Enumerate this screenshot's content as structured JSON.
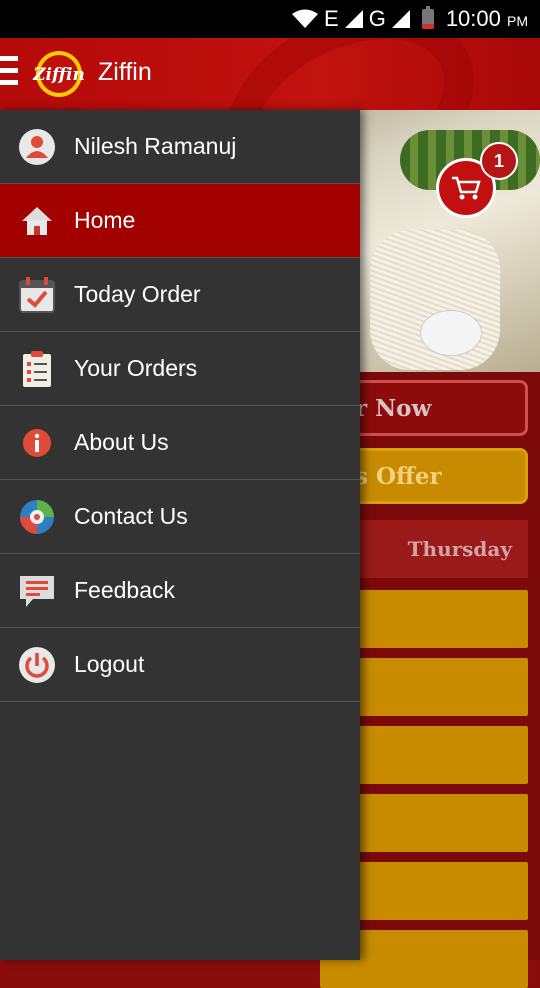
{
  "status_bar": {
    "network_e": "E",
    "network_g": "G",
    "time": "10:00",
    "ampm": "PM"
  },
  "app_bar": {
    "title": "Ziffin",
    "logo_text": "Ziffin",
    "accent_color": "#b40a0a"
  },
  "background": {
    "cart_count": "1",
    "order_button": "r Now",
    "offer_button": "s Offer",
    "day_label": "Thursday"
  },
  "drawer": {
    "user_name": "Nilesh Ramanuj",
    "items": [
      {
        "label": "Home",
        "icon": "home-icon",
        "active": true
      },
      {
        "label": "Today Order",
        "icon": "calendar-check-icon"
      },
      {
        "label": "Your Orders",
        "icon": "clipboard-list-icon"
      },
      {
        "label": "About Us",
        "icon": "info-icon"
      },
      {
        "label": "Contact Us",
        "icon": "contact-icon"
      },
      {
        "label": "Feedback",
        "icon": "feedback-icon"
      },
      {
        "label": "Logout",
        "icon": "power-icon"
      }
    ],
    "active_color": "#a30000",
    "background_color": "#333333"
  }
}
